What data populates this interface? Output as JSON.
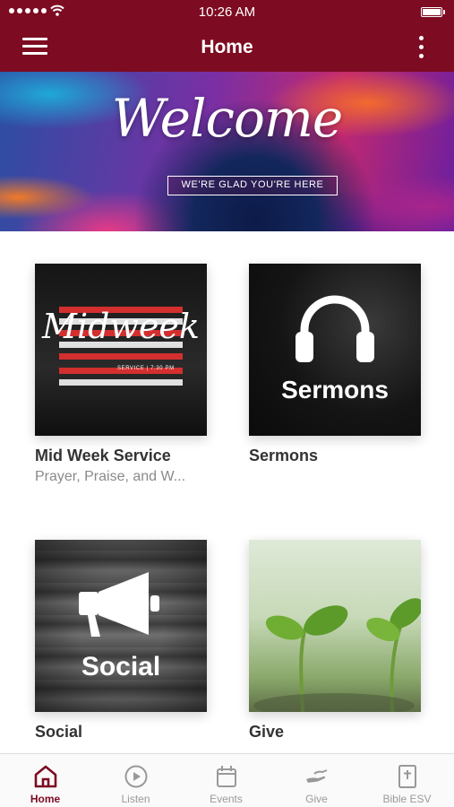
{
  "status_bar": {
    "time": "10:26 AM"
  },
  "header": {
    "title": "Home"
  },
  "banner": {
    "title": "Welcome",
    "subtitle": "WE'RE GLAD YOU'RE HERE"
  },
  "tiles": [
    {
      "title": "Mid Week Service",
      "subtitle": "Prayer, Praise, and W...",
      "image_text": "Midweek",
      "image_info": "SERVICE | 7:30 PM"
    },
    {
      "title": "Sermons",
      "subtitle": "",
      "image_text": "Sermons"
    },
    {
      "title": "Social",
      "subtitle": "",
      "image_text": "Social"
    },
    {
      "title": "Give",
      "subtitle": ""
    }
  ],
  "bottom_nav": [
    {
      "label": "Home",
      "icon": "home-icon",
      "active": true
    },
    {
      "label": "Listen",
      "icon": "play-icon",
      "active": false
    },
    {
      "label": "Events",
      "icon": "calendar-icon",
      "active": false
    },
    {
      "label": "Give",
      "icon": "give-hand-icon",
      "active": false
    },
    {
      "label": "Bible ESV",
      "icon": "bible-icon",
      "active": false
    }
  ],
  "colors": {
    "header": "#7d0b22",
    "active_tab": "#7d0b22",
    "inactive_tab": "#999999"
  }
}
